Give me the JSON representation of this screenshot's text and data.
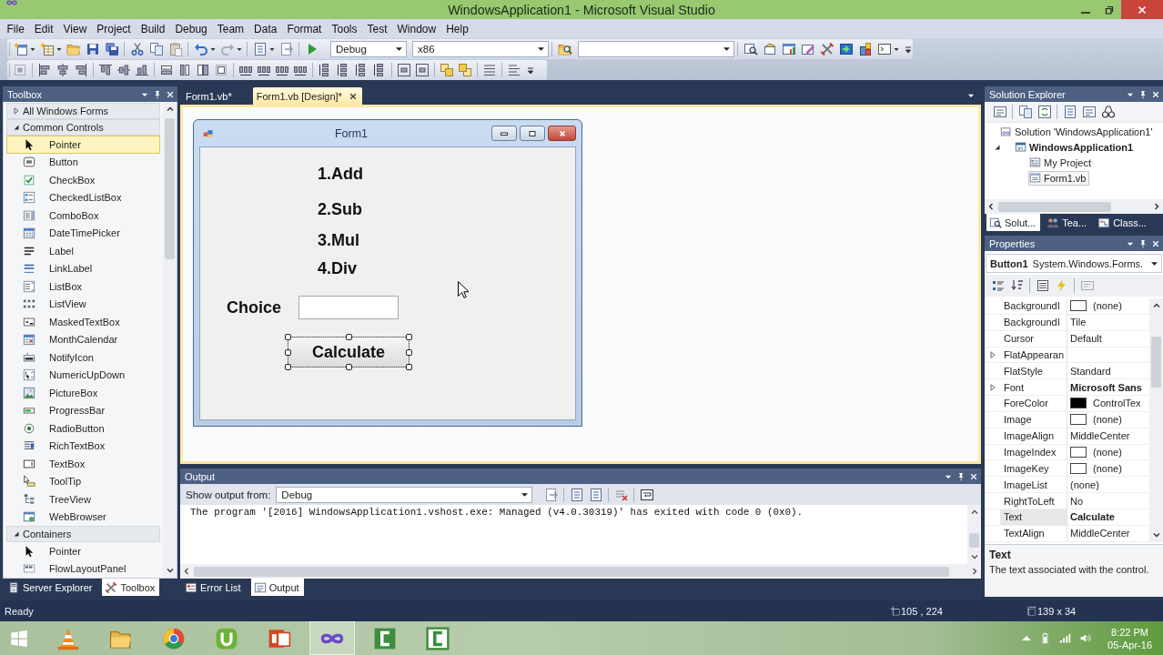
{
  "window": {
    "title": "WindowsApplication1 - Microsoft Visual Studio"
  },
  "menu": [
    "File",
    "Edit",
    "View",
    "Project",
    "Build",
    "Debug",
    "Team",
    "Data",
    "Format",
    "Tools",
    "Test",
    "Window",
    "Help"
  ],
  "toolbar": {
    "configuration": "Debug",
    "platform": "x86"
  },
  "toolbox": {
    "title": "Toolbox",
    "groups": [
      {
        "label": "All Windows Forms",
        "expanded": false
      },
      {
        "label": "Common Controls",
        "expanded": true,
        "items": [
          {
            "label": "Pointer",
            "selected": true
          },
          {
            "label": "Button",
            "selected": false
          },
          {
            "label": "CheckBox",
            "selected": false
          },
          {
            "label": "CheckedListBox",
            "selected": false
          },
          {
            "label": "ComboBox",
            "selected": false
          },
          {
            "label": "DateTimePicker",
            "selected": false
          },
          {
            "label": "Label",
            "selected": false
          },
          {
            "label": "LinkLabel",
            "selected": false
          },
          {
            "label": "ListBox",
            "selected": false
          },
          {
            "label": "ListView",
            "selected": false
          },
          {
            "label": "MaskedTextBox",
            "selected": false
          },
          {
            "label": "MonthCalendar",
            "selected": false
          },
          {
            "label": "NotifyIcon",
            "selected": false
          },
          {
            "label": "NumericUpDown",
            "selected": false
          },
          {
            "label": "PictureBox",
            "selected": false
          },
          {
            "label": "ProgressBar",
            "selected": false
          },
          {
            "label": "RadioButton",
            "selected": false
          },
          {
            "label": "RichTextBox",
            "selected": false
          },
          {
            "label": "TextBox",
            "selected": false
          },
          {
            "label": "ToolTip",
            "selected": false
          },
          {
            "label": "TreeView",
            "selected": false
          },
          {
            "label": "WebBrowser",
            "selected": false
          }
        ]
      },
      {
        "label": "Containers",
        "expanded": true,
        "items": [
          {
            "label": "Pointer",
            "selected": false
          },
          {
            "label": "FlowLayoutPanel",
            "selected": false
          }
        ]
      }
    ],
    "tabs": [
      {
        "label": "Server Explorer",
        "selected": false
      },
      {
        "label": "Toolbox",
        "selected": true
      }
    ]
  },
  "editor": {
    "tabs": [
      {
        "label": "Form1.vb*",
        "selected": false
      },
      {
        "label": "Form1.vb [Design]*",
        "selected": true
      }
    ],
    "form": {
      "title": "Form1",
      "labels": [
        "1.Add",
        "2.Sub",
        "3.Mul",
        "4.Div"
      ],
      "choice_label": "Choice",
      "button": "Calculate"
    }
  },
  "output": {
    "title": "Output",
    "source_label": "Show output from:",
    "source": "Debug",
    "lines": [
      "The program '[2016] WindowsApplication1.vshost.exe: Managed (v4.0.30319)' has exited with code 0 (0x0)."
    ],
    "tabs": [
      {
        "label": "Error List",
        "selected": false
      },
      {
        "label": "Output",
        "selected": true
      }
    ]
  },
  "solution_explorer": {
    "title": "Solution Explorer",
    "tree": [
      {
        "label": "Solution 'WindowsApplication1'",
        "kind": "solution",
        "children": [
          {
            "label": "WindowsApplication1",
            "kind": "project",
            "expanded": true,
            "children": [
              {
                "label": "My Project",
                "kind": "properties",
                "selected": false
              },
              {
                "label": "Form1.vb",
                "kind": "form",
                "selected": true
              }
            ]
          }
        ]
      }
    ],
    "tabs": [
      {
        "label": "Solut...",
        "selected": true
      },
      {
        "label": "Tea...",
        "selected": false
      },
      {
        "label": "Class...",
        "selected": false
      }
    ]
  },
  "properties": {
    "title": "Properties",
    "object_name": "Button1",
    "object_type": "System.Windows.Forms.",
    "rows": [
      {
        "name": "BackgroundI",
        "value": "(none)",
        "color": "#ffffff",
        "expandable": false,
        "modified": false,
        "selected": false
      },
      {
        "name": "BackgroundI",
        "value": "Tile",
        "expandable": false,
        "modified": false,
        "selected": false
      },
      {
        "name": "Cursor",
        "value": "Default",
        "expandable": false,
        "modified": false,
        "selected": false
      },
      {
        "name": "FlatAppearan",
        "expandable": true,
        "selected": false
      },
      {
        "name": "FlatStyle",
        "value": "Standard",
        "expandable": false,
        "modified": false,
        "selected": false
      },
      {
        "name": "Font",
        "value": "Microsoft Sans",
        "expandable": true,
        "modified": true,
        "selected": false
      },
      {
        "name": "ForeColor",
        "value": "ControlTex",
        "color": "#000000",
        "expandable": false,
        "modified": false,
        "selected": false
      },
      {
        "name": "Image",
        "value": "(none)",
        "color": "#ffffff",
        "expandable": false,
        "modified": false,
        "selected": false
      },
      {
        "name": "ImageAlign",
        "value": "MiddleCenter",
        "expandable": false,
        "modified": false,
        "selected": false
      },
      {
        "name": "ImageIndex",
        "value": "(none)",
        "color": "#ffffff",
        "expandable": false,
        "modified": false,
        "selected": false
      },
      {
        "name": "ImageKey",
        "value": "(none)",
        "color": "#ffffff",
        "expandable": false,
        "modified": false,
        "selected": false
      },
      {
        "name": "ImageList",
        "value": "(none)",
        "expandable": false,
        "modified": false,
        "selected": false
      },
      {
        "name": "RightToLeft",
        "value": "No",
        "expandable": false,
        "modified": false,
        "selected": false
      },
      {
        "name": "Text",
        "value": "Calculate",
        "expandable": false,
        "modified": true,
        "selected": true
      },
      {
        "name": "TextAlign",
        "value": "MiddleCenter",
        "expandable": false,
        "modified": false,
        "selected": false
      }
    ],
    "help_title": "Text",
    "help_text": "The text associated with the control."
  },
  "status_bar": {
    "text": "Ready",
    "position": "105 , 224",
    "size": "139 x 34"
  },
  "taskbar": {
    "apps": [
      {
        "active": false
      },
      {
        "active": false
      },
      {
        "active": false
      },
      {
        "active": false
      },
      {
        "active": false
      },
      {
        "active": true
      },
      {
        "active": false
      },
      {
        "active": false
      }
    ],
    "time": "8:22 PM",
    "date": "05-Apr-16"
  }
}
